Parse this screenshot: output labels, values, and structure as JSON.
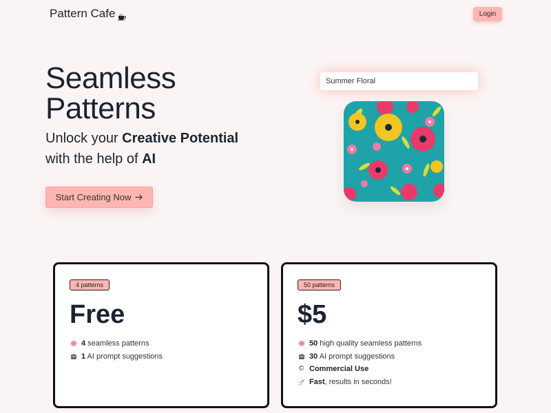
{
  "brand": {
    "name": "Pattern Cafe",
    "icon": "coffee-cup-icon"
  },
  "header": {
    "login_label": "Login"
  },
  "hero": {
    "title_line1": "Seamless",
    "title_line2": "Patterns",
    "sub_pre1": "Unlock your ",
    "sub_bold1": "Creative Potential",
    "sub_pre2": "with the help of ",
    "sub_bold2": "AI",
    "cta_label": "Start Creating Now",
    "cta_icon": "arrow-right-icon",
    "prompt_value": "Summer Floral",
    "pattern_image": "summer-floral-pattern"
  },
  "plans": {
    "free": {
      "badge": "4 patterns",
      "price": "Free",
      "features": [
        {
          "icon": "brain-icon",
          "bold": "4",
          "text": " seamless patterns"
        },
        {
          "icon": "robot-icon",
          "bold": "1",
          "text": " AI prompt suggestions"
        }
      ]
    },
    "paid": {
      "badge": "50 patterns",
      "price": "$5",
      "features": [
        {
          "icon": "brain-icon",
          "bold": "50",
          "text": " high quality seamless patterns"
        },
        {
          "icon": "robot-icon",
          "bold": "30",
          "text": " AI prompt suggestions"
        },
        {
          "icon": "copyright-icon",
          "bold": "Commercial Use",
          "text": ""
        },
        {
          "icon": "rocket-icon",
          "bold": "Fast",
          "text": ", results in seconds!"
        }
      ]
    }
  },
  "colors": {
    "accent": "#fdb6b2",
    "background": "#faf5f4",
    "pattern_bg": "#1fa3a8"
  }
}
